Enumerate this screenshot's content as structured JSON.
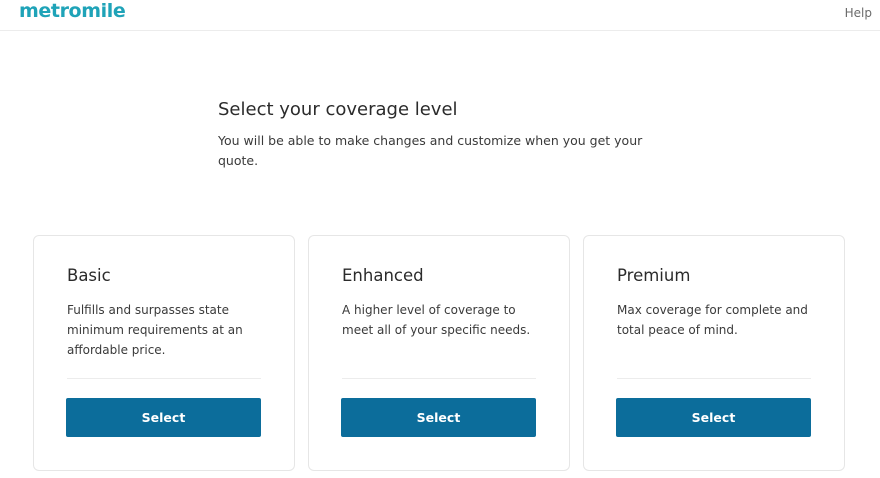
{
  "header": {
    "logo_text": "metromile",
    "help_label": "Help"
  },
  "main": {
    "title": "Select your coverage level",
    "subtitle": "You will be able to make changes and customize when you get your quote."
  },
  "plans": [
    {
      "name": "Basic",
      "description": "Fulfills and surpasses state minimum requirements at an affordable price.",
      "button_label": "Select"
    },
    {
      "name": "Enhanced",
      "description": "A higher level of coverage to meet all of your specific needs.",
      "button_label": "Select"
    },
    {
      "name": "Premium",
      "description": "Max coverage for complete and total peace of mind.",
      "button_label": "Select"
    }
  ],
  "colors": {
    "brand": "#1fa3b8",
    "button": "#0c6d9b",
    "card_border": "#e6e6e6"
  }
}
